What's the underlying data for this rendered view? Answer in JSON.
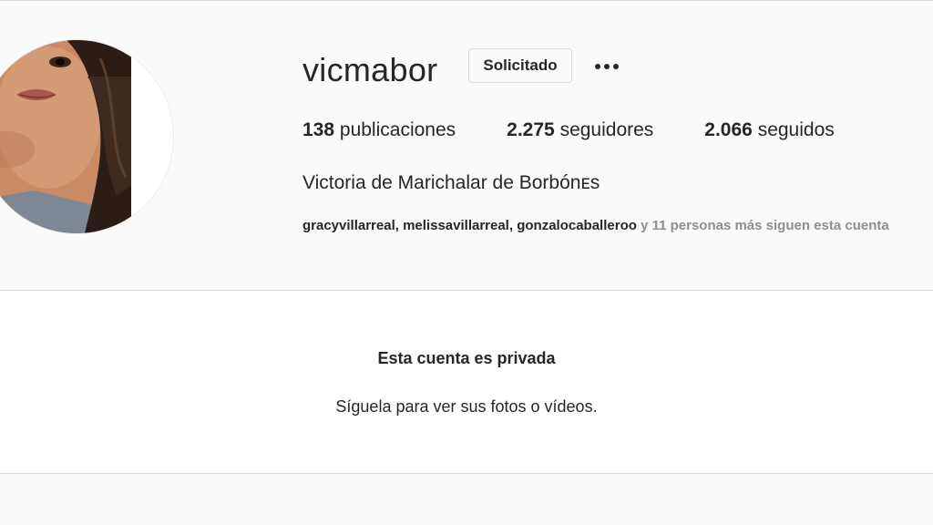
{
  "profile": {
    "username": "vicmabor",
    "request_button_label": "Solicitado",
    "more_icon": "more-horizontal-icon",
    "stats": {
      "posts_count": "138",
      "posts_label": "publicaciones",
      "followers_count": "2.275",
      "followers_label": "seguidores",
      "following_count": "2.066",
      "following_label": "seguidos"
    },
    "full_name": "Victoria de Marichalar de Borbónᴇs",
    "followed_by": {
      "accounts": [
        "gracyvillarreal",
        "melissavillarreal",
        "gonzalocaballeroo"
      ],
      "separator": ", ",
      "others_text": "y 11 personas más siguen esta cuenta"
    }
  },
  "private_notice": {
    "title": "Esta cuenta es privada",
    "subtitle": "Síguela para ver sus fotos o vídeos."
  },
  "colors": {
    "background": "#fafafa",
    "text": "#262626",
    "muted": "#8e8e8e",
    "border": "#dbdbdb"
  }
}
